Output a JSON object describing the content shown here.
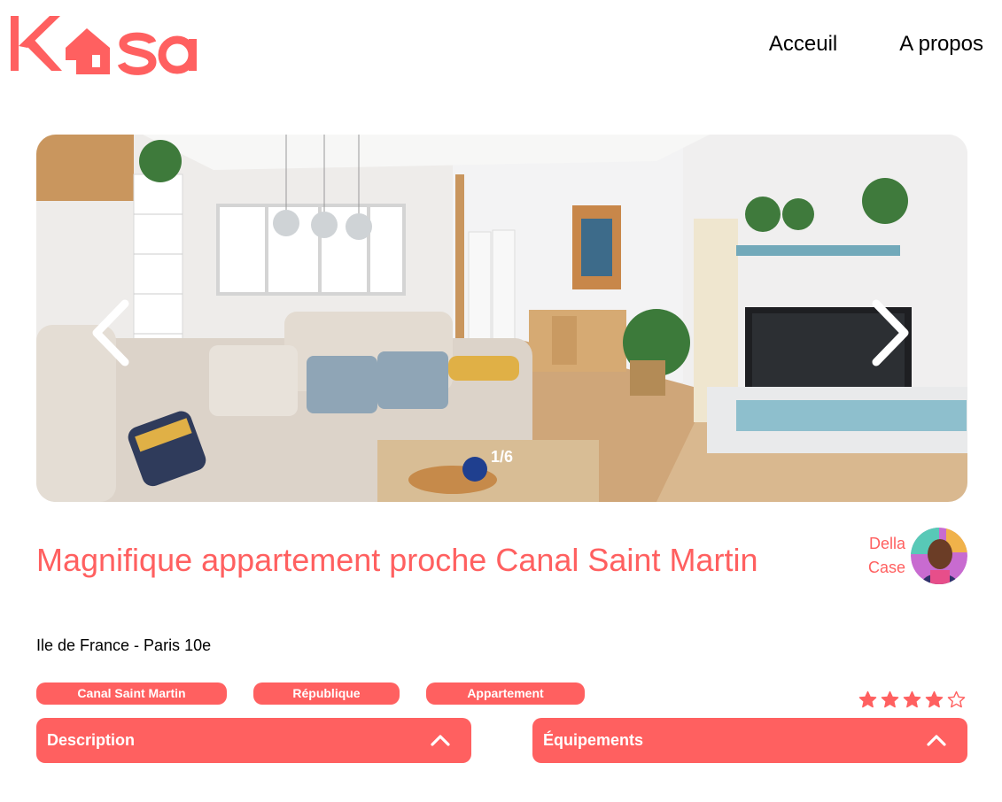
{
  "header": {
    "logo_text": "Kasa",
    "nav": [
      {
        "label": "Acceuil"
      },
      {
        "label": "A propos"
      }
    ]
  },
  "carousel": {
    "counter": "1/6",
    "current": 1,
    "total": 6
  },
  "listing": {
    "title": "Magnifique appartement proche Canal Saint Martin",
    "location": "Ile de France - Paris 10e",
    "host_name": "Della Case",
    "tags": [
      "Canal Saint Martin",
      "République",
      "Appartement"
    ],
    "rating": 4,
    "rating_max": 5
  },
  "collapses": [
    {
      "label": "Description"
    },
    {
      "label": "Équipements"
    }
  ],
  "colors": {
    "accent": "#FF6060",
    "text": "#000000",
    "background": "#FFFFFF"
  },
  "icons": {
    "prev": "chevron-left-icon",
    "next": "chevron-right-icon",
    "collapse": "chevron-up-icon",
    "star_full": "star-filled-icon",
    "star_empty": "star-outline-icon"
  }
}
